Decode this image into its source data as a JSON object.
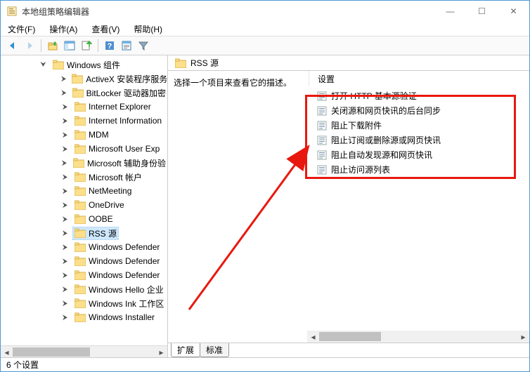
{
  "window": {
    "title": "本地组策略编辑器",
    "controls": {
      "minimize": "—",
      "maximize": "☐",
      "close": "✕"
    }
  },
  "menu": {
    "file": "文件(F)",
    "action": "操作(A)",
    "view": "查看(V)",
    "help": "帮助(H)"
  },
  "tree": {
    "parent": "Windows 组件",
    "items": [
      "ActiveX 安装程序服务",
      "BitLocker 驱动器加密",
      "Internet Explorer",
      "Internet Information",
      "MDM",
      "Microsoft User Exp",
      "Microsoft 辅助身份验",
      "Microsoft 帐户",
      "NetMeeting",
      "OneDrive",
      "OOBE",
      "RSS 源",
      "Windows Defender",
      "Windows Defender",
      "Windows Defender",
      "Windows Hello 企业",
      "Windows Ink 工作区",
      "Windows Installer"
    ],
    "selected_index": 11
  },
  "detail": {
    "header": "RSS 源",
    "prompt": "选择一个项目来查看它的描述。",
    "column_header": "设置",
    "settings": [
      "打开 HTTP 基本源验证",
      "关闭源和网页快讯的后台同步",
      "阻止下载附件",
      "阻止订阅或删除源或网页快讯",
      "阻止自动发现源和网页快讯",
      "阻止访问源列表"
    ]
  },
  "tabs": {
    "extended": "扩展",
    "standard": "标准"
  },
  "status": "6 个设置"
}
